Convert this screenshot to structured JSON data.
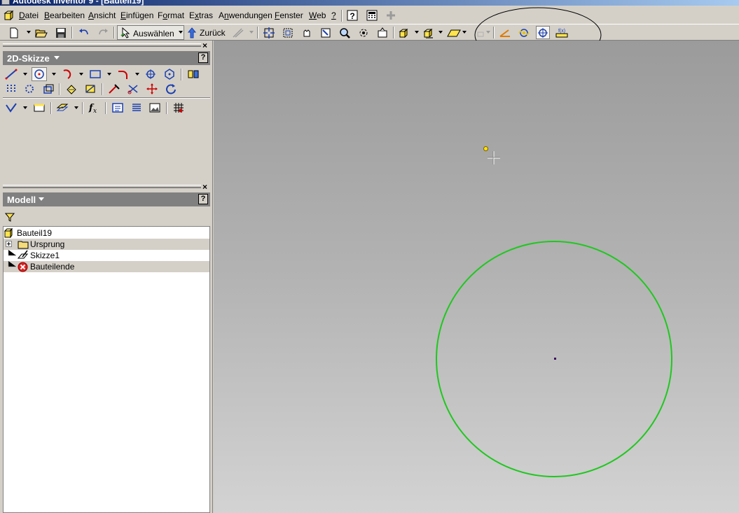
{
  "window": {
    "title": "Autodesk Inventor 9 - [Bauteil19]"
  },
  "menu": {
    "items": [
      {
        "pre": "",
        "u": "D",
        "post": "atei"
      },
      {
        "pre": "",
        "u": "B",
        "post": "earbeiten"
      },
      {
        "pre": "",
        "u": "A",
        "post": "nsicht"
      },
      {
        "pre": "",
        "u": "E",
        "post": "infügen"
      },
      {
        "pre": "F",
        "u": "o",
        "post": "rmat"
      },
      {
        "pre": "E",
        "u": "x",
        "post": "tras"
      },
      {
        "pre": "A",
        "u": "n",
        "post": "wendungen"
      },
      {
        "pre": "",
        "u": "F",
        "post": "enster"
      },
      {
        "pre": "",
        "u": "W",
        "post": "eb"
      },
      {
        "pre": "",
        "u": "?",
        "post": ""
      }
    ]
  },
  "toolbar": {
    "select_label": "Auswählen",
    "back_label": "Zurück"
  },
  "sketch_panel": {
    "title": "2D-Skizze"
  },
  "model_panel": {
    "title": "Modell",
    "tree": [
      {
        "label": "Bauteil19"
      },
      {
        "label": "Ursprung"
      },
      {
        "label": "Skizze1"
      },
      {
        "label": "Bauteilende"
      }
    ]
  },
  "colors": {
    "sketch_circle": "#1ec81e",
    "accent_blue": "#0a246a",
    "annotation_ellipse": "#000000"
  }
}
